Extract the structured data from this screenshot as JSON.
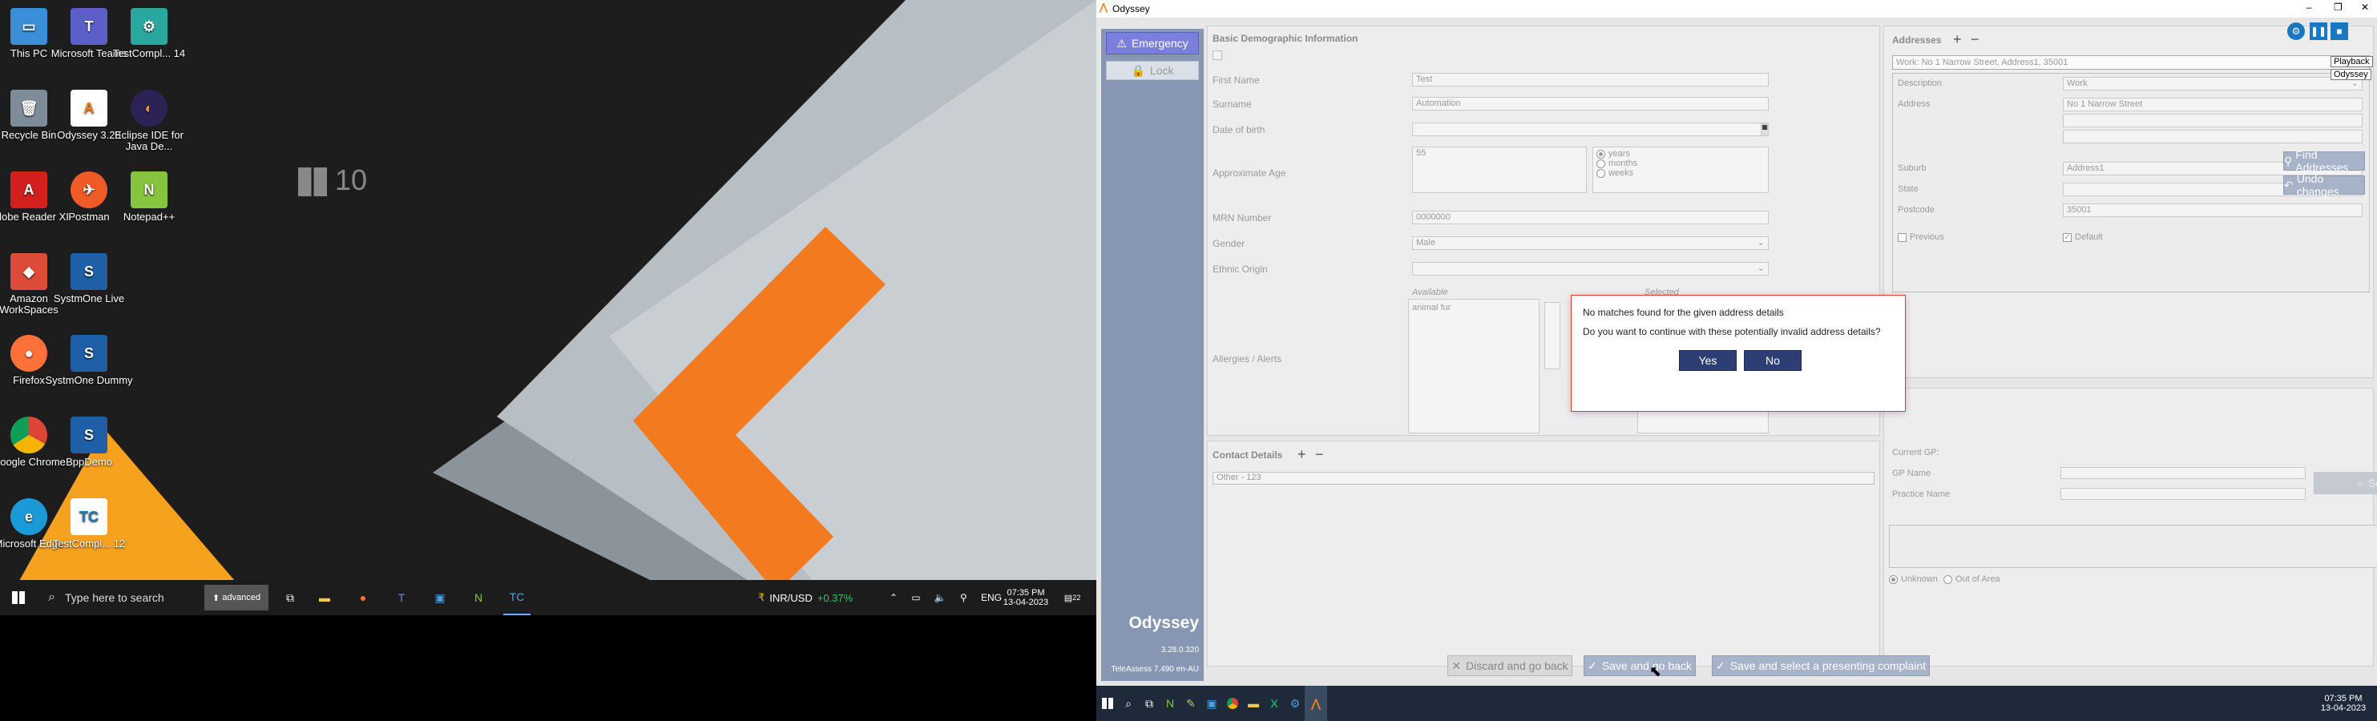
{
  "desktop": {
    "icons": [
      {
        "label": "This PC"
      },
      {
        "label": "Microsoft Teams"
      },
      {
        "label": "TestCompl... 14"
      },
      {
        "label": "Recycle Bin"
      },
      {
        "label": "Odyssey 3.28"
      },
      {
        "label": "Eclipse IDE for Java De..."
      },
      {
        "label": "Adobe Reader XI"
      },
      {
        "label": "Postman"
      },
      {
        "label": "Notepad++"
      },
      {
        "label": "Amazon WorkSpaces"
      },
      {
        "label": "SystmOne Live"
      },
      {
        "label": "Firefox"
      },
      {
        "label": "SystmOne Dummy"
      },
      {
        "label": "Google Chrome"
      },
      {
        "label": "BppDemo"
      },
      {
        "label": "Microsoft Edge"
      },
      {
        "label": "TestCompl... 12"
      }
    ],
    "win_logo_text": "10"
  },
  "left_taskbar": {
    "search_placeholder": "Type here to search",
    "advanced_label": "advanced",
    "currency": "INR/USD",
    "currency_change": "+0.37%",
    "lang": "ENG",
    "time": "07:35 PM",
    "date": "13-04-2023",
    "notif_count": "22"
  },
  "app": {
    "title": "Odyssey",
    "tooltip_playback": "Playback",
    "tooltip_odyssey": "Odyssey",
    "sidebar": {
      "emergency_label": "Emergency",
      "lock_label": "Lock",
      "brand": "Odyssey",
      "version": "3.28.0.320",
      "teleassess": "TeleAssess 7.490 en-AU"
    },
    "demographics": {
      "section_title": "Basic Demographic Information",
      "first_name_label": "First Name",
      "first_name_value": "Test",
      "surname_label": "Surname",
      "surname_value": "Automation",
      "dob_label": "Date of birth",
      "approx_age_label": "Approximate Age",
      "approx_age_value": "55",
      "age_units": [
        "years",
        "months",
        "weeks"
      ],
      "mrn_label": "MRN Number",
      "mrn_value": "0000000",
      "gender_label": "Gender",
      "gender_value": "Male",
      "ethnic_label": "Ethnic Origin",
      "available_label": "Available",
      "selected_label": "Selected",
      "allergies_label": "Allergies / Alerts",
      "available_item": "animal fur"
    },
    "contact": {
      "section_title": "Contact Details",
      "item": "Other - 123"
    },
    "addresses": {
      "section_title": "Addresses",
      "selected": "Work: No 1 Narrow Street, Address1, 35001",
      "description_label": "Description",
      "description_value": "Work",
      "address_label": "Address",
      "address_value": "No 1 Narrow Street",
      "suburb_label": "Suburb",
      "suburb_value": "Address1",
      "state_label": "State",
      "postcode_label": "Postcode",
      "postcode_value": "35001",
      "previous_label": "Previous",
      "default_label": "Default",
      "find_button": "Find Addresses",
      "undo_button": "Undo changes"
    },
    "gp": {
      "current_gp_label": "Current GP:",
      "gp_name_label": "GP Name",
      "practice_label": "Practice Name",
      "search_button": "Search",
      "unknown_label": "Unknown",
      "out_of_area_label": "Out of Area"
    },
    "dialog": {
      "line1": "No matches found for the given address details",
      "line2": "Do you want to continue with these potentially invalid address details?",
      "yes": "Yes",
      "no": "No"
    },
    "footer": {
      "discard": "Discard and go back",
      "save_back": "Save and go back",
      "save_complaint": "Save and select a presenting complaint"
    }
  },
  "right_taskbar": {
    "time": "07:35 PM",
    "date": "13-04-2023"
  },
  "colors": {
    "accent_orange": "#f77f22",
    "sidebar": "#8696b3",
    "button_blue": "#2c3e74",
    "dialog_border": "#e03a3a"
  }
}
